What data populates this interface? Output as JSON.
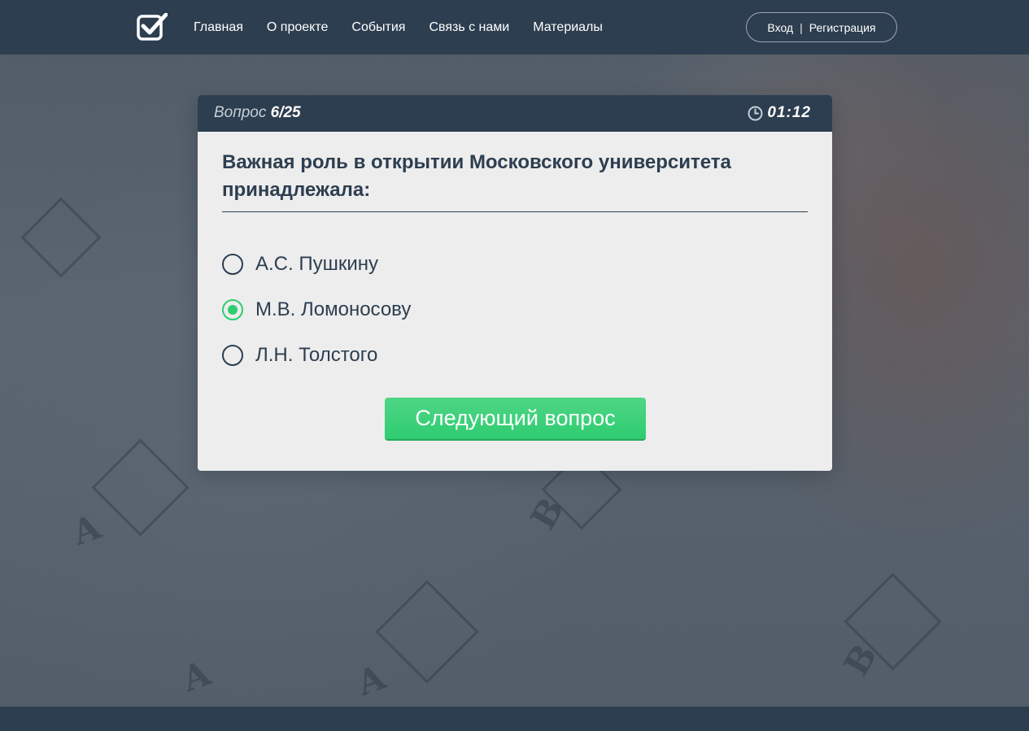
{
  "header": {
    "logo_icon": "checkbox-check-icon",
    "nav": [
      {
        "label": "Главная"
      },
      {
        "label": "О проекте"
      },
      {
        "label": "События"
      },
      {
        "label": "Связь с нами"
      },
      {
        "label": "Материалы"
      }
    ],
    "auth": {
      "login_label": "Вход",
      "separator": "|",
      "register_label": "Регистрация"
    }
  },
  "quiz": {
    "counter_label": "Вопрос",
    "counter_value": "6/25",
    "current_question": 6,
    "total_questions": 25,
    "timer_icon": "clock-icon",
    "timer": "01:12",
    "question": "Важная роль в открытии Московского университета принадлежала:",
    "options": [
      {
        "label": "А.С. Пушкину",
        "selected": false
      },
      {
        "label": "М.В. Ломоносову",
        "selected": true
      },
      {
        "label": "Л.Н. Толстого",
        "selected": false
      }
    ],
    "next_label": "Следующий вопрос"
  },
  "colors": {
    "header_bg": "#2d3e50",
    "accent_green": "#2ecc71",
    "text_dark": "#2d3e50",
    "card_bg": "#ededed"
  }
}
